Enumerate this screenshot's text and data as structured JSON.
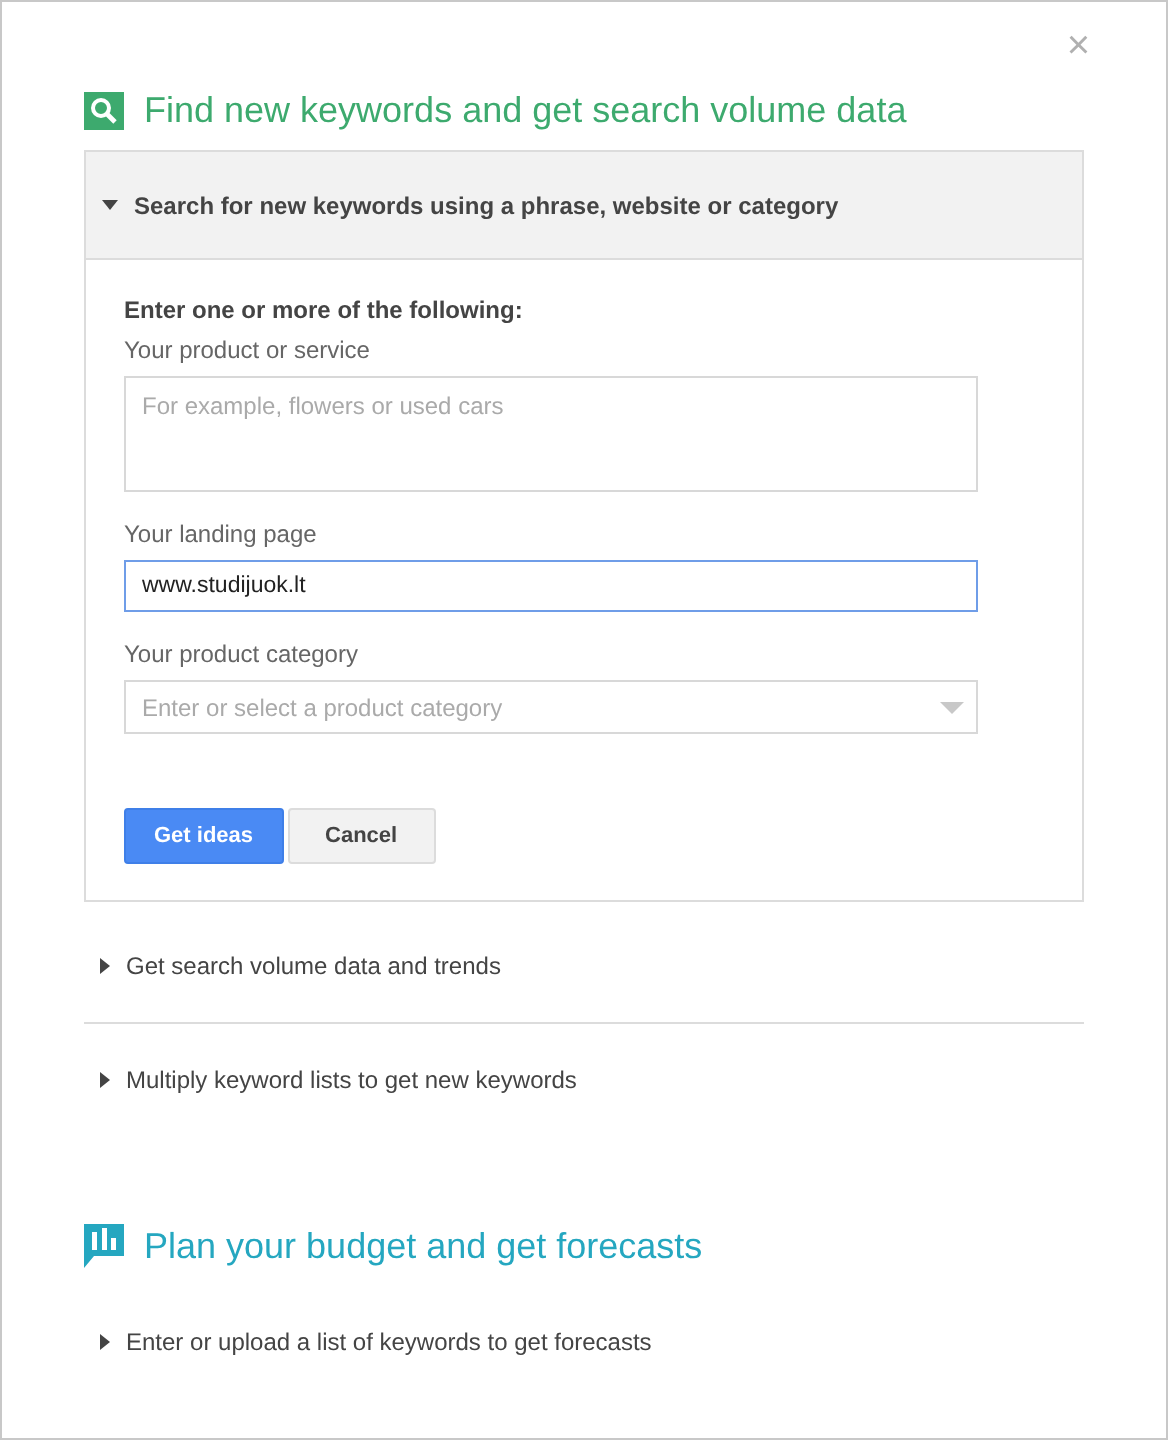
{
  "close_button": "×",
  "sections": [
    {
      "title": "Find new keywords and get search volume data",
      "kind": "search",
      "color": "#3daa6e",
      "panels": [
        {
          "label": "Search for new keywords using a phrase, website or category",
          "expanded": true,
          "form": {
            "intro": "Enter one or more of the following:",
            "fields": [
              {
                "kind": "textarea",
                "label": "Your product or service",
                "placeholder": "For example, flowers or used cars",
                "focused": false
              },
              {
                "kind": "input",
                "label": "Your landing page",
                "value": "www.studijuok.lt",
                "focused": true
              },
              {
                "kind": "select",
                "label": "Your product category",
                "placeholder": "Enter or select a product category",
                "focused": false
              }
            ],
            "buttons": [
              {
                "label": "Get ideas",
                "primary": true
              },
              {
                "label": "Cancel",
                "primary": false
              }
            ]
          }
        },
        {
          "label": "Get search volume data and trends",
          "expanded": false
        },
        {
          "label": "Multiply keyword lists to get new keywords",
          "expanded": false
        }
      ]
    },
    {
      "title": "Plan your budget and get forecasts",
      "kind": "chart",
      "color": "#25a7c0",
      "panels": [
        {
          "label": "Enter or upload a list of keywords to get forecasts",
          "expanded": false
        }
      ]
    }
  ]
}
